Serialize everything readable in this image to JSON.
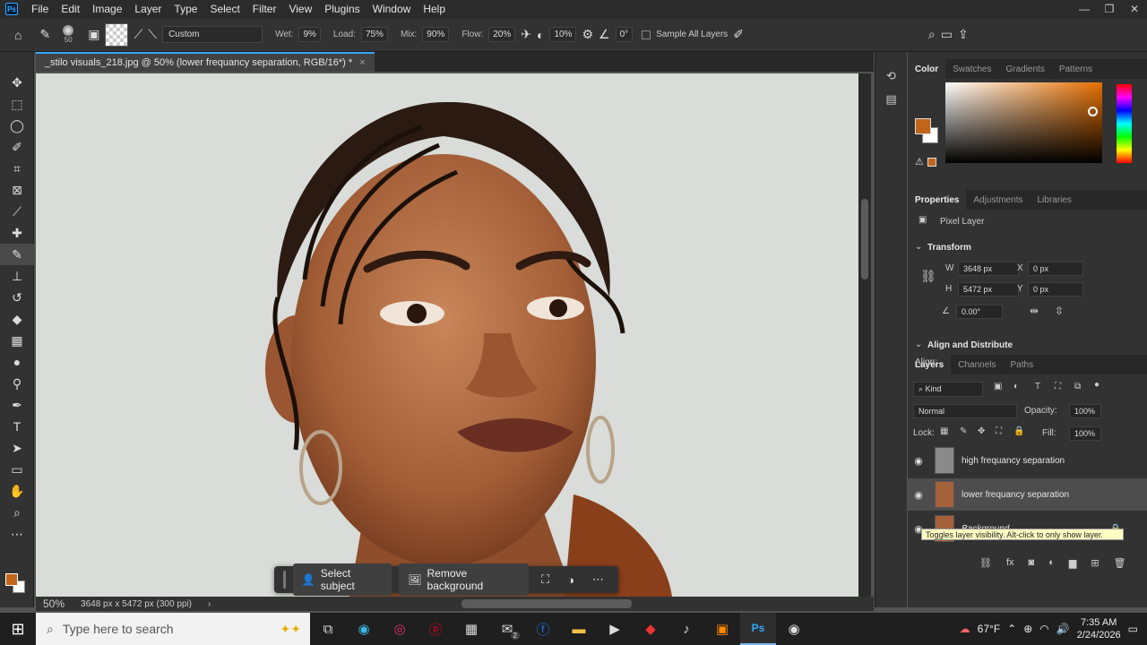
{
  "menu": [
    "File",
    "Edit",
    "Image",
    "Layer",
    "Type",
    "Select",
    "Filter",
    "View",
    "Plugins",
    "Window",
    "Help"
  ],
  "app_logo": "Ps",
  "options": {
    "brush_size": "50",
    "preset": "Custom",
    "wet_label": "Wet:",
    "wet": "9%",
    "load_label": "Load:",
    "load": "75%",
    "mix_label": "Mix:",
    "mix": "90%",
    "flow_label": "Flow:",
    "flow": "20%",
    "smoothing": "10%",
    "angle": "0°",
    "sample_all_layers": "Sample All Layers"
  },
  "document_tab": {
    "title": "_stilo visuals_218.jpg @ 50% (lower frequancy separation, RGB/16*) *",
    "close": "×"
  },
  "status": {
    "zoom": "50%",
    "doc_size": "3648 px x 5472 px (300 ppi)"
  },
  "context_bar": {
    "select_subject": "Select subject",
    "remove_background": "Remove background"
  },
  "color_panel": {
    "tabs": [
      "Color",
      "Swatches",
      "Gradients",
      "Patterns"
    ],
    "fg": "#c1651b",
    "bg": "#ffffff"
  },
  "properties": {
    "tabs": [
      "Properties",
      "Adjustments",
      "Libraries"
    ],
    "kind": "Pixel Layer",
    "transform_label": "Transform",
    "w_label": "W",
    "w": "3648 px",
    "h_label": "H",
    "h": "5472 px",
    "x_label": "X",
    "x": "0 px",
    "y_label": "Y",
    "y": "0 px",
    "angle": "0.00°",
    "align_label": "Align and Distribute",
    "align_sub": "Align:"
  },
  "layers_panel": {
    "tabs": [
      "Layers",
      "Channels",
      "Paths"
    ],
    "kind_filter": "Kind",
    "blend_mode": "Normal",
    "opacity_label": "Opacity:",
    "opacity": "100%",
    "lock_label": "Lock:",
    "fill_label": "Fill:",
    "fill": "100%",
    "layers": [
      {
        "name": "high frequancy separation"
      },
      {
        "name": "lower frequancy separation"
      },
      {
        "name": "Background"
      }
    ],
    "tooltip": "Toggles layer visibility. Alt-click to only show layer."
  },
  "taskbar": {
    "search_placeholder": "Type here to search",
    "weather": "67°F",
    "time": "7:35 AM",
    "date": "2/24/2026",
    "mail_badge": "2"
  },
  "colors": {
    "accent": "#31a8ff",
    "fg_swatch": "#c1651b"
  }
}
